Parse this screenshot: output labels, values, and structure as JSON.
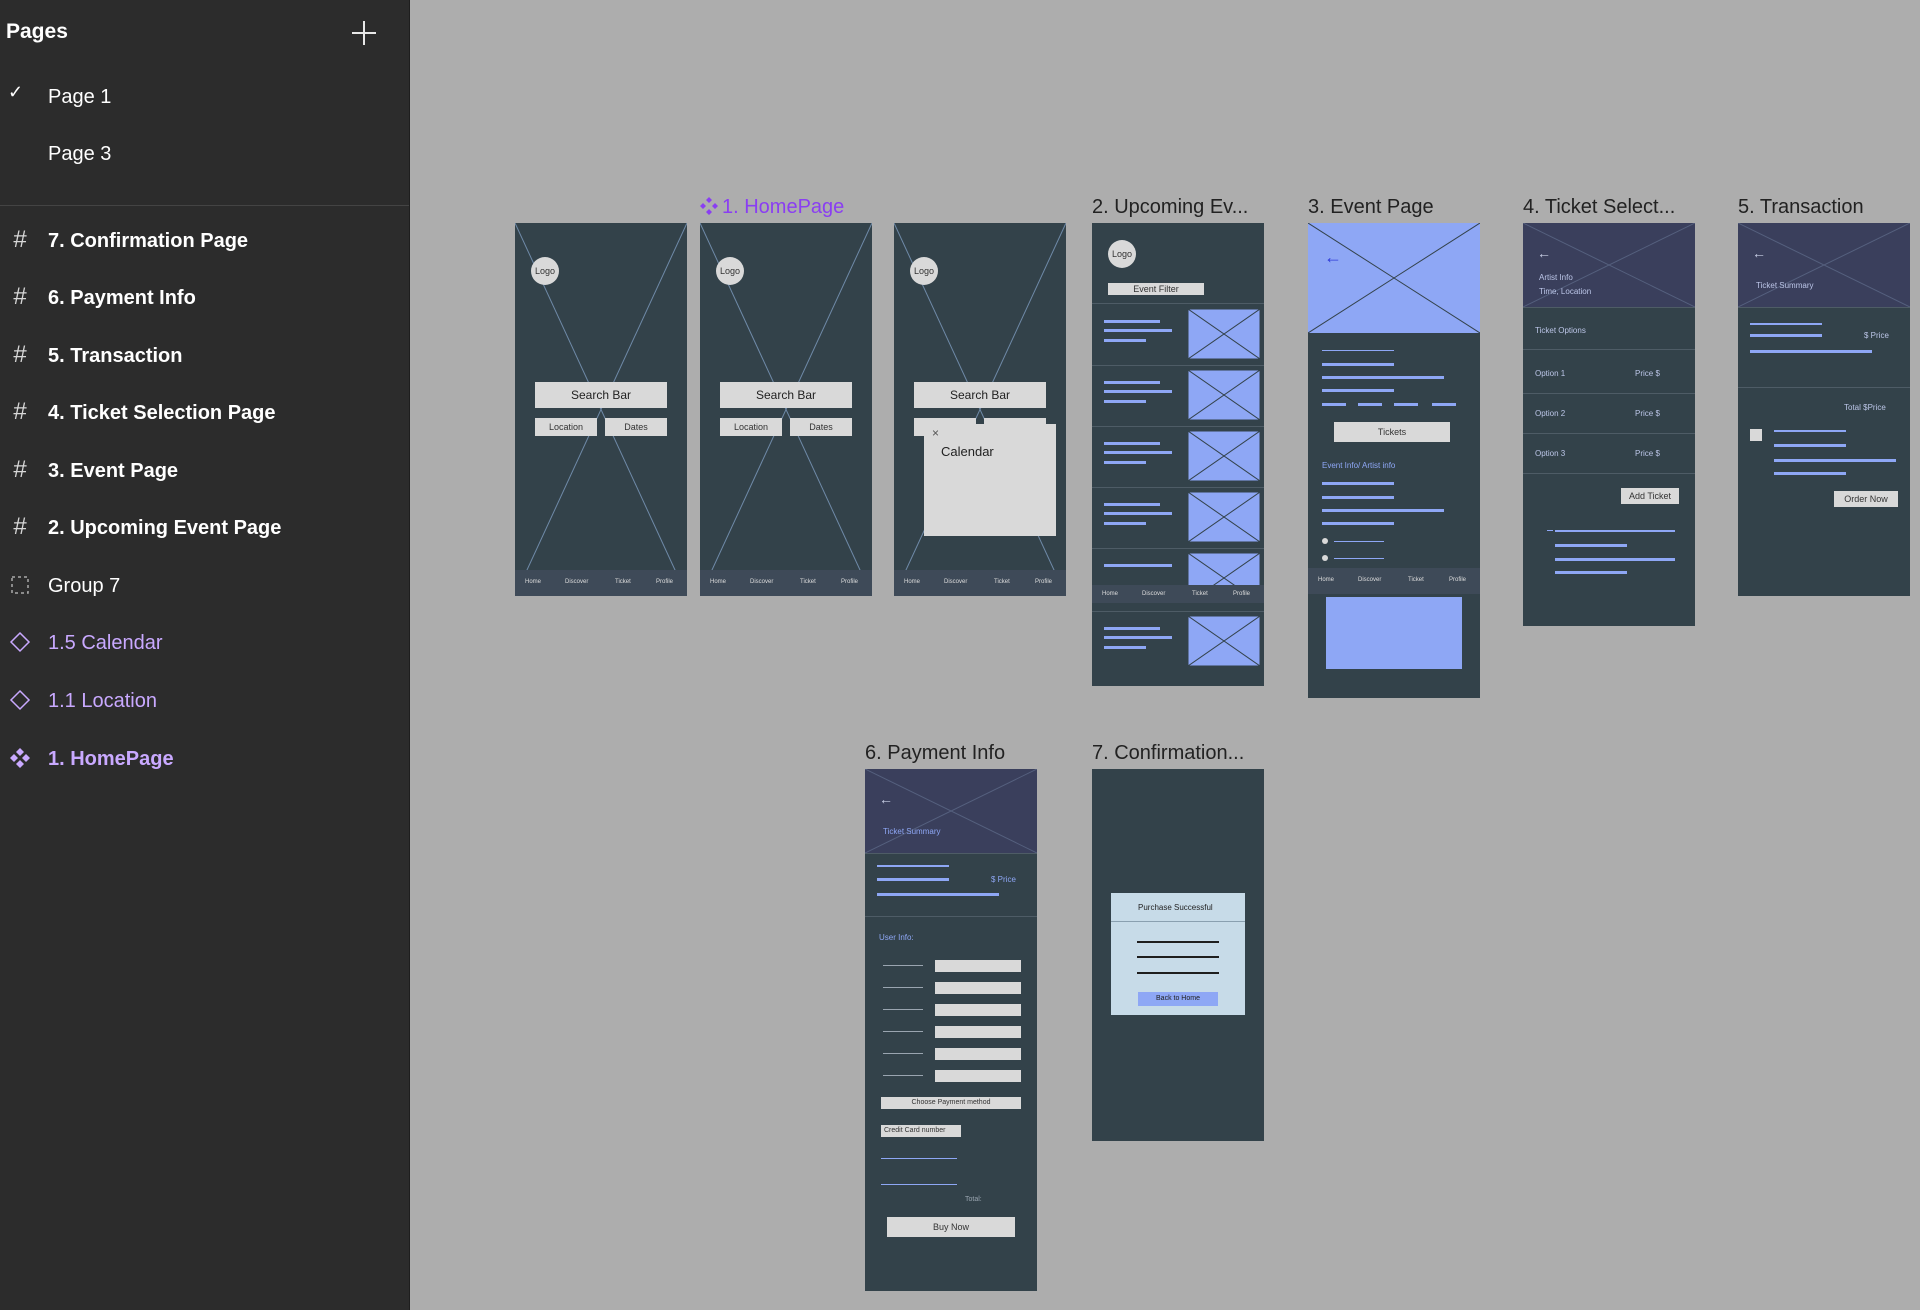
{
  "sidebar": {
    "header": "Pages",
    "pages": [
      {
        "label": "Page 1",
        "checked": true
      },
      {
        "label": "Page 3",
        "checked": false
      }
    ],
    "layers": [
      {
        "label": "7. Confirmation Page",
        "kind": "frame",
        "icon": "hash-icon"
      },
      {
        "label": "6. Payment Info",
        "kind": "frame",
        "icon": "hash-icon"
      },
      {
        "label": "5. Transaction",
        "kind": "frame",
        "icon": "hash-icon"
      },
      {
        "label": "4. Ticket Selection Page",
        "kind": "frame",
        "icon": "hash-icon"
      },
      {
        "label": "3. Event Page",
        "kind": "frame",
        "icon": "hash-icon"
      },
      {
        "label": "2. Upcoming Event Page",
        "kind": "frame",
        "icon": "hash-icon"
      },
      {
        "label": "Group 7",
        "kind": "group",
        "icon": "dashed-square-icon"
      },
      {
        "label": "1.5 Calendar",
        "kind": "component",
        "icon": "diamond-icon"
      },
      {
        "label": "1.1 Location",
        "kind": "component",
        "icon": "diamond-icon"
      },
      {
        "label": "1. HomePage",
        "kind": "component-main",
        "icon": "component-icon"
      }
    ]
  },
  "canvas": {
    "titles": {
      "homepage": "1. HomePage",
      "upcoming": "2. Upcoming Ev...",
      "event": "3. Event Page",
      "ticket": "4. Ticket Select...",
      "transaction": "5. Transaction",
      "payment": "6. Payment Info",
      "confirmation": "7. Confirmation..."
    },
    "home": {
      "logo": "Logo",
      "search": "Search Bar",
      "location": "Location",
      "dates": "Dates",
      "calendar": "Calendar",
      "nav": [
        "Home",
        "Discover",
        "Ticket",
        "Profile"
      ]
    },
    "upcoming": {
      "logo": "Logo",
      "filter": "Event Filter",
      "nav": [
        "Home",
        "Discover",
        "Ticket",
        "Profile"
      ]
    },
    "event": {
      "tickets": "Tickets",
      "info": "Event Info/ Artist info",
      "nav": [
        "Home",
        "Discover",
        "Ticket",
        "Profile"
      ]
    },
    "ticket": {
      "artist": "Artist Info",
      "time": "Time, Location",
      "options_label": "Ticket Options",
      "options": [
        {
          "name": "Option 1",
          "price": "Price $"
        },
        {
          "name": "Option 2",
          "price": "Price $"
        },
        {
          "name": "Option 3",
          "price": "Price $"
        }
      ],
      "add": "Add Ticket"
    },
    "transaction": {
      "summary": "Ticket Summary",
      "price": "$ Price",
      "total": "Total $Price",
      "order": "Order Now"
    },
    "payment": {
      "summary": "Ticket Summary",
      "price": "$ Price",
      "user": "User Info:",
      "method": "Choose Payment method",
      "card": "Credit Card number",
      "total": "Total:",
      "buy": "Buy Now"
    },
    "confirmation": {
      "success": "Purchase Successful",
      "back": "Back to Home"
    }
  }
}
